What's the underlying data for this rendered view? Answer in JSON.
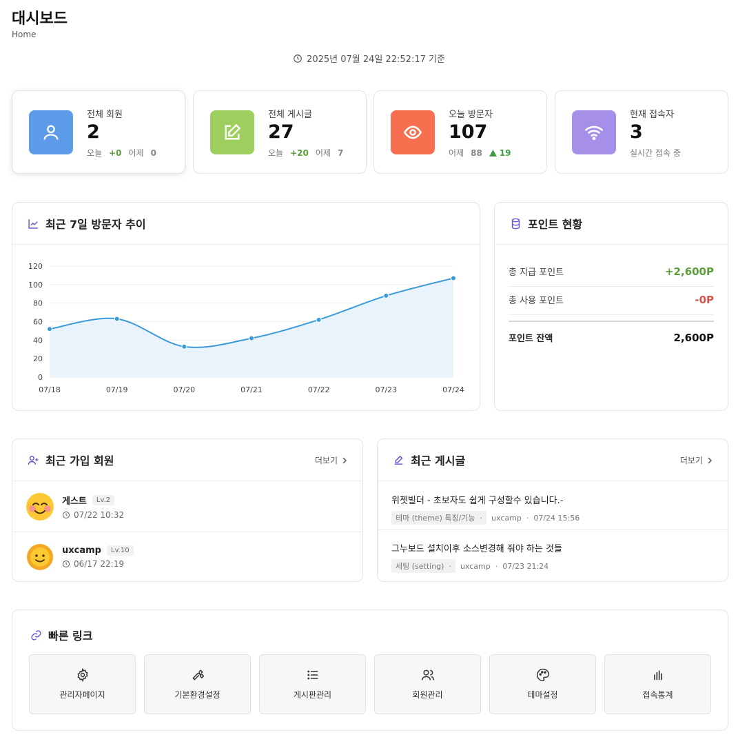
{
  "header": {
    "title": "대시보드",
    "breadcrumb": "Home",
    "timestamp": "2025년 07월 24일 22:52:17 기준"
  },
  "stats": [
    {
      "label": "전체 회원",
      "value": "2",
      "sub1_label": "오늘",
      "sub1_value": "+0",
      "sub2_label": "어제",
      "sub2_value": "0",
      "icon": "user-icon",
      "color": "#5b9be8"
    },
    {
      "label": "전체 게시글",
      "value": "27",
      "sub1_label": "오늘",
      "sub1_value": "+20",
      "sub2_label": "어제",
      "sub2_value": "7",
      "icon": "edit-icon",
      "color": "#9ecf5e"
    },
    {
      "label": "오늘 방문자",
      "value": "107",
      "sub1_label": "어제",
      "sub1_value": "88",
      "sub2_value": "19",
      "icon": "eye-icon",
      "color": "#f86f4f"
    },
    {
      "label": "현재 접속자",
      "value": "3",
      "sub1_label": "실시간 접속 중",
      "icon": "wifi-icon",
      "color": "#a58fe8"
    }
  ],
  "visitor_chart": {
    "title": "최근 7일 방문자 추이",
    "chart_data": {
      "type": "area",
      "categories": [
        "07/18",
        "07/19",
        "07/20",
        "07/21",
        "07/22",
        "07/23",
        "07/24"
      ],
      "values": [
        52,
        63,
        33,
        42,
        62,
        88,
        107
      ],
      "ylim": [
        0,
        120
      ],
      "yticks": [
        0,
        20,
        40,
        60,
        80,
        100,
        120
      ],
      "grid": true,
      "line_color": "#3a9ad9",
      "fill_color": "#e8f3fb"
    }
  },
  "points": {
    "title": "포인트 현황",
    "rows": [
      {
        "label": "총 지급 포인트",
        "value": "+2,600P"
      },
      {
        "label": "총 사용 포인트",
        "value": "-0P"
      },
      {
        "label": "포인트 잔액",
        "value": "2,600P"
      }
    ]
  },
  "recent_members": {
    "title": "최근 가입 회원",
    "more": "더보기",
    "items": [
      {
        "name": "게스트",
        "level": "Lv.2",
        "date": "07/22 10:32",
        "avatar": "smiling-face-icon"
      },
      {
        "name": "uxcamp",
        "level": "Lv.10",
        "date": "06/17 22:19",
        "avatar": "sun-face-icon"
      }
    ]
  },
  "recent_posts": {
    "title": "최근 게시글",
    "more": "더보기",
    "items": [
      {
        "title": "위젯빌더 - 초보자도 쉽게 구성할수 있습니다.-",
        "category": "테마 (theme) 특징/기능",
        "author": "uxcamp",
        "date": "07/24 15:56"
      },
      {
        "title": "그누보드 설치이후 소스변경해 줘야 하는 것들",
        "category": "세팅 (setting)",
        "author": "uxcamp",
        "date": "07/23 21:24"
      }
    ]
  },
  "quick_links": {
    "title": "빠른 링크",
    "items": [
      {
        "label": "관리자페이지",
        "icon": "gear-icon"
      },
      {
        "label": "기본환경설정",
        "icon": "wrench-icon"
      },
      {
        "label": "게시판관리",
        "icon": "list-icon"
      },
      {
        "label": "회원관리",
        "icon": "users-icon"
      },
      {
        "label": "테마설정",
        "icon": "palette-icon"
      },
      {
        "label": "접속통계",
        "icon": "bar-chart-icon"
      }
    ]
  }
}
